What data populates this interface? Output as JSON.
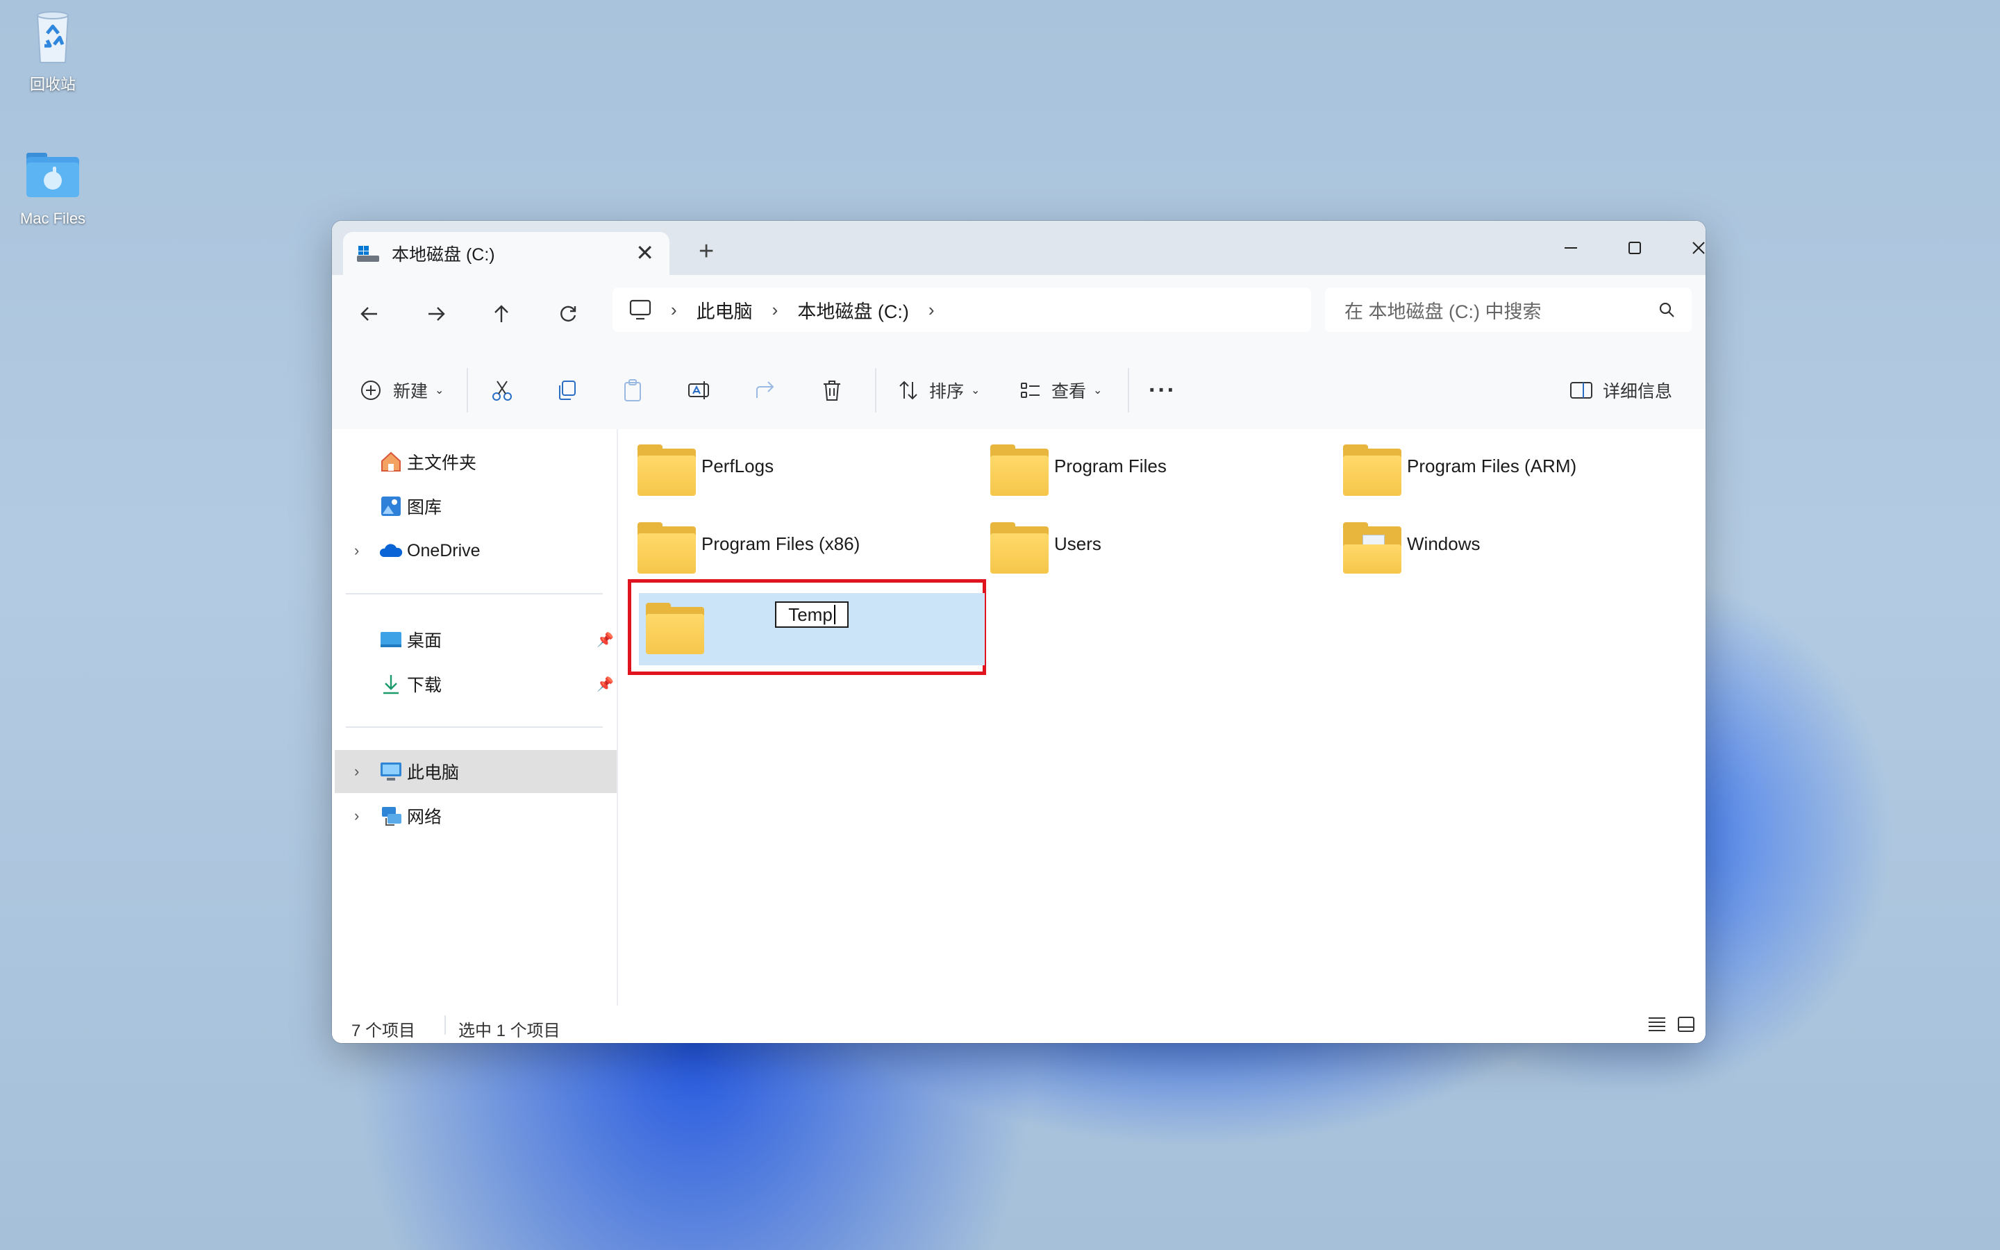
{
  "desktop": {
    "icons": [
      {
        "label": "回收站",
        "icon": "recycle-bin-icon"
      },
      {
        "label": "Mac Files",
        "icon": "folder-apple-icon"
      }
    ]
  },
  "window": {
    "tab_title": "本地磁盘 (C:)",
    "new_tab": "+",
    "controls": {
      "minimize": "minimize-icon",
      "maximize": "maximize-icon",
      "close": "close-icon"
    },
    "breadcrumb": [
      "此电脑",
      "本地磁盘 (C:)"
    ],
    "search_placeholder": "在 本地磁盘 (C:) 中搜索",
    "toolbar": {
      "new_label": "新建",
      "sort_label": "排序",
      "view_label": "查看",
      "more_label": "···",
      "details_label": "详细信息"
    },
    "sidebar": {
      "quick": [
        {
          "label": "主文件夹",
          "icon": "home-icon"
        },
        {
          "label": "图库",
          "icon": "gallery-icon"
        },
        {
          "label": "OneDrive",
          "icon": "onedrive-icon"
        }
      ],
      "pinned": [
        {
          "label": "桌面",
          "icon": "desktop-icon"
        },
        {
          "label": "下载",
          "icon": "download-icon"
        }
      ],
      "devices": [
        {
          "label": "此电脑",
          "icon": "this-pc-icon",
          "selected": true
        },
        {
          "label": "网络",
          "icon": "network-icon"
        }
      ]
    },
    "folders": [
      {
        "name": "PerfLogs"
      },
      {
        "name": "Program Files"
      },
      {
        "name": "Program Files (ARM)"
      },
      {
        "name": "Program Files (x86)"
      },
      {
        "name": "Users"
      },
      {
        "name": "Windows"
      }
    ],
    "renaming_folder": {
      "value": "Temp"
    },
    "status": {
      "items_count": "7 个项目",
      "selected": "选中 1 个项目"
    },
    "colors": {
      "accent": "#0067c0",
      "selection": "#cce4f7",
      "highlight_box": "#e0141e",
      "folder": "#f6c64a"
    }
  }
}
